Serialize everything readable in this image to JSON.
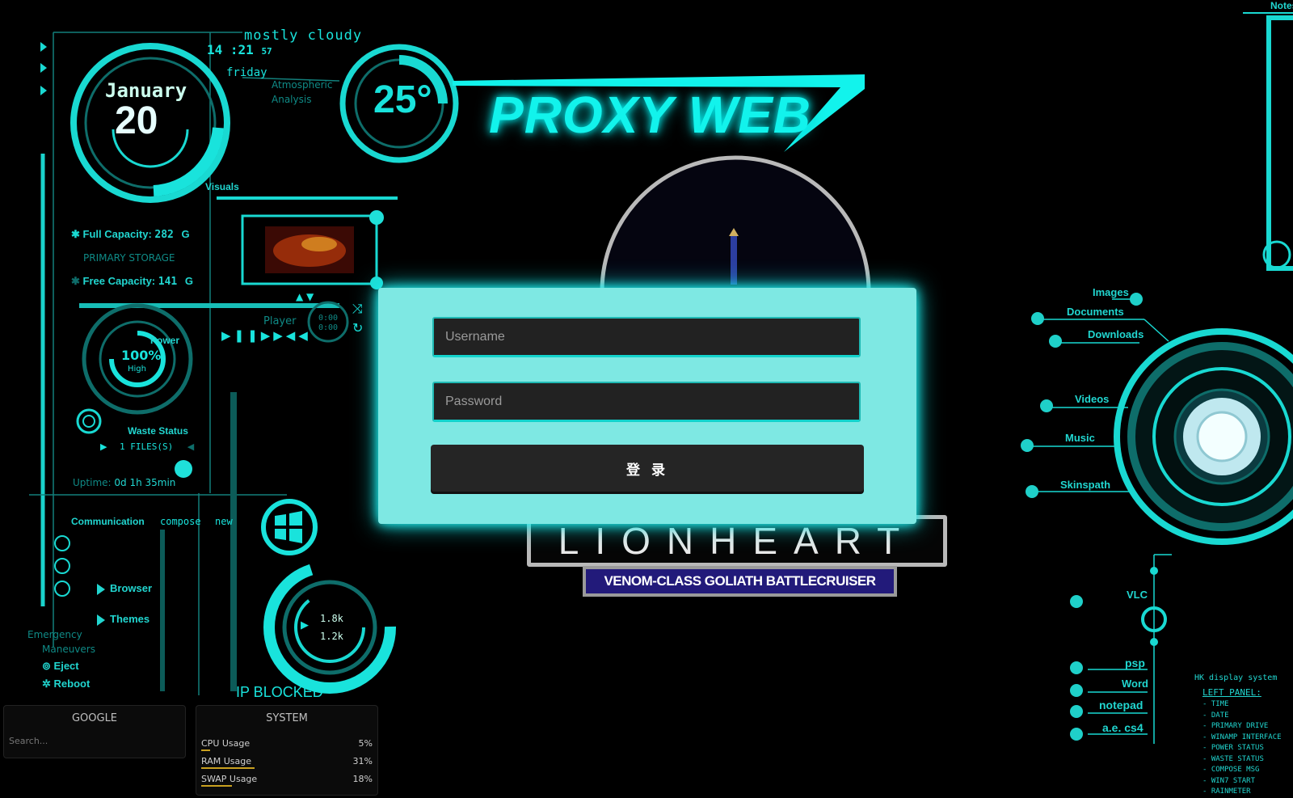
{
  "title": "PROXY WEB",
  "weather": {
    "condition": "mostly cloudy",
    "time": "14 :21",
    "seconds": "57",
    "day": "friday",
    "temp": "25°",
    "analysis": "Atmospheric Analysis"
  },
  "calendar": {
    "month": "January",
    "date": "20"
  },
  "storage": {
    "full_label": "Full Capacity:",
    "full_value": "282",
    "unit": "G",
    "primary_label": "PRIMARY STORAGE",
    "free_label": "Free Capacity:",
    "free_value": "141",
    "visuals_label": "Visuals"
  },
  "player": {
    "label": "Player",
    "time1": "0:00",
    "time2": "0:00"
  },
  "power": {
    "label": "Power",
    "percent": "100%",
    "level": "High"
  },
  "waste": {
    "label": "Waste Status",
    "files": "1 FILES(S)"
  },
  "uptime": {
    "label": "Uptime:",
    "value": "0d 1h 35min"
  },
  "communication": {
    "label": "Communication",
    "compose": "compose",
    "new": "new"
  },
  "left_menu": {
    "browser": "Browser",
    "themes": "Themes",
    "emergency": "Emergency",
    "maneuvers": "Maneuvers",
    "eject": "Eject",
    "reboot": "Reboot"
  },
  "network": {
    "down": "1.8k",
    "up": "1.2k",
    "blocked": "IP  BLOCKED"
  },
  "google": {
    "title": "GOOGLE",
    "search_placeholder": "Search..."
  },
  "system": {
    "title": "SYSTEM",
    "rows": [
      {
        "label": "CPU Usage",
        "value": "5%",
        "fill": 0.05
      },
      {
        "label": "RAM Usage",
        "value": "31%",
        "fill": 0.31
      },
      {
        "label": "SWAP Usage",
        "value": "18%",
        "fill": 0.18
      }
    ]
  },
  "login": {
    "username_placeholder": "Username",
    "password_placeholder": "Password",
    "button": "登 录"
  },
  "emblem": {
    "name": "LIONHEART",
    "subtitle": "VENOM-CLASS GOLIATH BATTLECRUISER"
  },
  "right_menu": {
    "images": "Images",
    "documents": "Documents",
    "downloads": "Downloads",
    "videos": "Videos",
    "music": "Music",
    "skinspath": "Skinspath",
    "vlc": "VLC",
    "psp": "psp",
    "word": "Word",
    "notepad": "notepad",
    "aecs4": "a.e. cs4",
    "notes": "Notes"
  },
  "legend": {
    "title": "HK display system",
    "subtitle": "LEFT PANEL:",
    "items": [
      "- TIME",
      "- DATE",
      "- PRIMARY DRIVE",
      "- WINAMP INTERFACE",
      "- POWER STATUS",
      "- WASTE STATUS",
      "- COMPOSE MSG",
      "- WIN7 START",
      "- RAINMETER"
    ]
  },
  "colors": {
    "accent": "#19e3dc",
    "panel": "#7ee8e3",
    "button": "#252525",
    "emblem_blue": "#221a7a"
  }
}
